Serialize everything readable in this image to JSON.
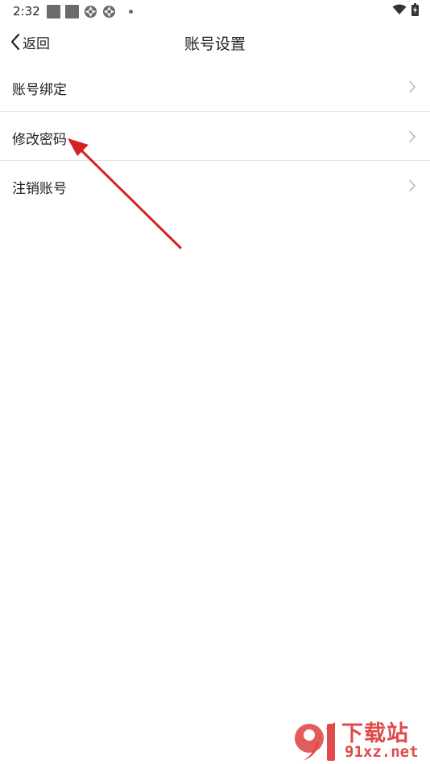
{
  "status_bar": {
    "time": "2:32",
    "notification_icons": [
      "square-notification-icon",
      "square-notification-icon",
      "aperture-icon",
      "aperture-icon",
      "dot-icon"
    ],
    "system_icons": [
      "wifi-icon",
      "battery-charging-icon"
    ]
  },
  "nav": {
    "back_label": "返回",
    "title": "账号设置"
  },
  "menu": {
    "items": [
      {
        "label": "账号绑定"
      },
      {
        "label": "修改密码"
      },
      {
        "label": "注销账号"
      }
    ]
  },
  "annotation": {
    "type": "red-arrow",
    "target": "修改密码",
    "color": "#d32222"
  },
  "watermark": {
    "cn": "下载站",
    "en": "91xz.net",
    "color": "#e04a4a"
  }
}
